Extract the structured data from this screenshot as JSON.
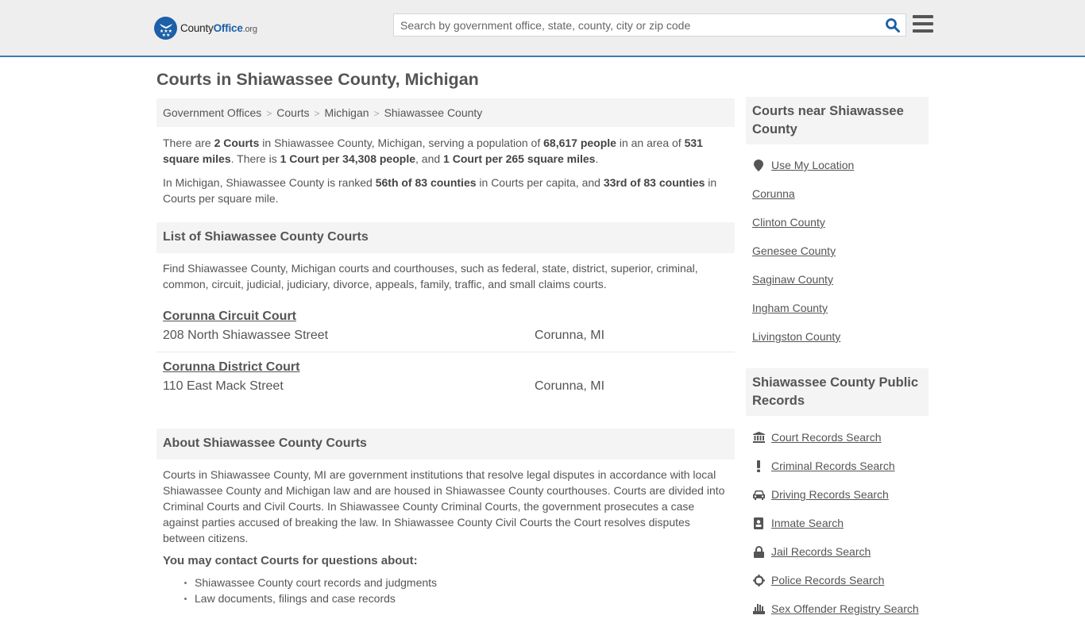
{
  "header": {
    "logo": {
      "name_part1": "County",
      "name_part2": "Office",
      "name_part3": ".org"
    },
    "search_placeholder": "Search by government office, state, county, city or zip code",
    "search_value": ""
  },
  "colors": {
    "brand_blue": "#1d5fa8",
    "header_border": "#3a7db5",
    "panel_bg": "#f4f4f4",
    "text": "#555555"
  },
  "page_title": "Courts in Shiawassee County, Michigan",
  "breadcrumb": [
    "Government Offices",
    "Courts",
    "Michigan",
    "Shiawassee County"
  ],
  "intro": {
    "p1": {
      "t1": "There are ",
      "b1": "2 Courts",
      "t2": " in Shiawassee County, Michigan, serving a population of ",
      "b2": "68,617 people",
      "t3": " in an area of ",
      "b3": "531 square miles",
      "t4": ". There is ",
      "b4": "1 Court per 34,308 people",
      "t5": ", and ",
      "b5": "1 Court per 265 square miles",
      "t6": "."
    },
    "p2": {
      "t1": "In Michigan, Shiawassee County is ranked ",
      "b1": "56th of 83 counties",
      "t2": " in Courts per capita, and ",
      "b2": "33rd of 83 counties",
      "t3": " in Courts per square mile."
    }
  },
  "list_section": {
    "heading": "List of Shiawassee County Courts",
    "description": "Find Shiawassee County, Michigan courts and courthouses, such as federal, state, district, superior, criminal, common, circuit, judicial, judiciary, divorce, appeals, family, traffic, and small claims courts.",
    "courts": [
      {
        "name": "Corunna Circuit Court",
        "address": "208 North Shiawassee Street",
        "city": "Corunna, MI"
      },
      {
        "name": "Corunna District Court",
        "address": "110 East Mack Street",
        "city": "Corunna, MI"
      }
    ]
  },
  "about_section": {
    "heading": "About Shiawassee County Courts",
    "body": "Courts in Shiawassee County, MI are government institutions that resolve legal disputes in accordance with local Shiawassee County and Michigan law and are housed in Shiawassee County courthouses. Courts are divided into Criminal Courts and Civil Courts. In Shiawassee County Criminal Courts, the government prosecutes a case against parties accused of breaking the law. In Shiawassee County Civil Courts the Court resolves disputes between citizens.",
    "contact_heading": "You may contact Courts for questions about:",
    "contact_items": [
      "Shiawassee County court records and judgments",
      "Law documents, filings and case records"
    ]
  },
  "sidebar": {
    "nearby": {
      "heading": "Courts near Shiawassee County",
      "use_location": {
        "label": "Use My Location",
        "icon": "map-marker-icon"
      },
      "links": [
        "Corunna",
        "Clinton County",
        "Genesee County",
        "Saginaw County",
        "Ingham County",
        "Livingston County"
      ]
    },
    "records": {
      "heading": "Shiawassee County Public Records",
      "links": [
        {
          "label": "Court Records Search",
          "icon": "courthouse-icon"
        },
        {
          "label": "Criminal Records Search",
          "icon": "exclamation-icon"
        },
        {
          "label": "Driving Records Search",
          "icon": "car-icon"
        },
        {
          "label": "Inmate Search",
          "icon": "id-badge-icon"
        },
        {
          "label": "Jail Records Search",
          "icon": "lock-icon"
        },
        {
          "label": "Police Records Search",
          "icon": "crosshairs-icon"
        },
        {
          "label": "Sex Offender Registry Search",
          "icon": "hand-icon"
        }
      ]
    }
  }
}
